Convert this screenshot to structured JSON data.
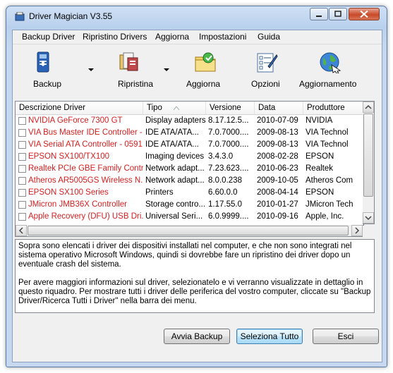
{
  "window": {
    "title": "Driver Magician V3.55"
  },
  "menubar": {
    "items": [
      "Backup Driver",
      "Ripristino Drivers",
      "Aggiorna",
      "Impostazioni",
      "Guida"
    ]
  },
  "toolbar": {
    "buttons": [
      {
        "label": "Backup",
        "icon": "backup-icon",
        "has_dropdown": true
      },
      {
        "label": "Ripristina",
        "icon": "restore-icon",
        "has_dropdown": true
      },
      {
        "label": "Aggiorna",
        "icon": "update-folder-icon",
        "has_dropdown": false
      },
      {
        "label": "Opzioni",
        "icon": "options-icon",
        "has_dropdown": false
      },
      {
        "label": "Aggiornamento",
        "icon": "globe-update-icon",
        "has_dropdown": false
      }
    ]
  },
  "driver_list": {
    "columns": [
      "Descrizione Driver",
      "Tipo",
      "Versione",
      "Data",
      "Produttore"
    ],
    "sorted_column": "Tipo",
    "rows": [
      {
        "name": "NVIDIA GeForce 7300 GT",
        "type": "Display adapters",
        "version": "8.17.12.5...",
        "date": "2010-07-09",
        "vendor": "NVIDIA"
      },
      {
        "name": "VIA Bus Master IDE Controller - ...",
        "type": "IDE ATA/ATA...",
        "version": "7.0.7000....",
        "date": "2009-08-13",
        "vendor": "VIA Technol"
      },
      {
        "name": "VIA Serial ATA Controller - 0591",
        "type": "IDE ATA/ATA...",
        "version": "7.0.7000....",
        "date": "2009-08-13",
        "vendor": "VIA Technol"
      },
      {
        "name": "EPSON SX100/TX100",
        "type": "Imaging devices",
        "version": "3.4.3.0",
        "date": "2008-02-28",
        "vendor": "EPSON"
      },
      {
        "name": "Realtek PCIe GBE Family Contr...",
        "type": "Network adapt...",
        "version": "7.23.623....",
        "date": "2010-06-23",
        "vendor": "Realtek"
      },
      {
        "name": "Atheros AR5005GS Wireless N...",
        "type": "Network adapt...",
        "version": "8.0.0.238",
        "date": "2009-10-05",
        "vendor": "Atheros Com"
      },
      {
        "name": "EPSON SX100 Series",
        "type": "Printers",
        "version": "6.60.0.0",
        "date": "2008-04-14",
        "vendor": "EPSON"
      },
      {
        "name": "JMicron JMB36X Controller",
        "type": "Storage contro...",
        "version": "1.17.55.0",
        "date": "2010-01-27",
        "vendor": "JMicron Tech"
      },
      {
        "name": "Apple Recovery (DFU) USB Dri...",
        "type": "Universal Seri...",
        "version": "6.0.9999....",
        "date": "2010-09-16",
        "vendor": "Apple, Inc."
      }
    ]
  },
  "description": {
    "paragraph1": "Sopra sono elencati i driver dei dispositivi installati nel computer, e che non sono integrati nel sistema operativo Microsoft Windows, quindi si dovrebbe fare un ripristino dei driver dopo un eventuale crash del sistema.",
    "paragraph2": "Per avere maggiori informazioni sul driver, selezionatelo e vi verranno visualizzate in dettaglio in questo riquadro. Per mostrare tutti i driver delle periferica del vostro computer, cliccate su \"Backup Driver/Ricerca Tutti i Driver\" nella barra dei menu."
  },
  "buttons": {
    "start_backup": "Avvia Backup",
    "select_all": "Seleziona Tutto",
    "exit": "Esci"
  },
  "colors": {
    "driver_name_text": "#d42020",
    "title_bar": "#c5d8ef",
    "close_button": "#c94a2a"
  }
}
